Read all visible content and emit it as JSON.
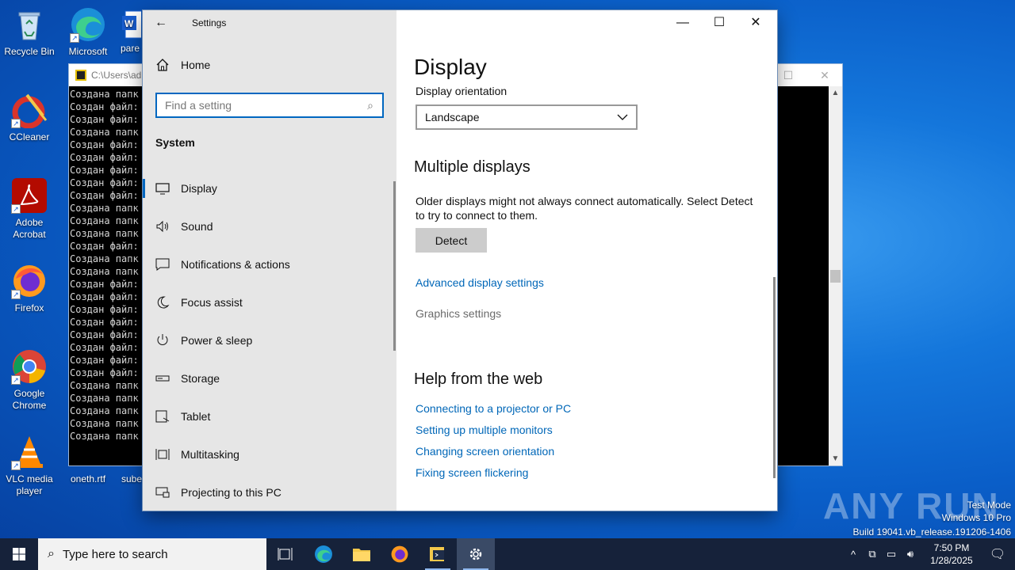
{
  "desktop": {
    "icons": [
      {
        "label": "Recycle Bin",
        "icon": "recycle-bin-icon"
      },
      {
        "label": "Microsoft Edge",
        "icon": "edge-icon"
      },
      {
        "label": "CCleaner",
        "icon": "ccleaner-icon"
      },
      {
        "label": "Adobe Acrobat",
        "icon": "acrobat-icon"
      },
      {
        "label": "Firefox",
        "icon": "firefox-icon"
      },
      {
        "label": "Google Chrome",
        "icon": "chrome-icon"
      },
      {
        "label": "VLC media player",
        "icon": "vlc-icon"
      }
    ],
    "partial_labels": [
      "pare",
      "oneth.rtf",
      "sube"
    ]
  },
  "console": {
    "title": "C:\\Users\\adı",
    "lines": [
      "Создана папк",
      "Создан файл:",
      "Создан файл:",
      "Создана папк",
      "Создан файл:",
      "Создан файл:",
      "Создан файл:",
      "Создан файл:",
      "Создан файл:",
      "Создана папк",
      "Создана папк",
      "Создана папк",
      "Создан файл:",
      "Создана папк",
      "Создана папк",
      "Создан файл:",
      "Создан файл:",
      "Создан файл:",
      "Создан файл:",
      "Создан файл:",
      "Создан файл:",
      "Создан файл:",
      "Создан файл:",
      "Создана папк",
      "Создана папк",
      "Создана папк",
      "Создана папк",
      "Создана папк"
    ]
  },
  "settings": {
    "app_title": "Settings",
    "home_label": "Home",
    "search_placeholder": "Find a setting",
    "section_title": "System",
    "nav_items": [
      {
        "label": "Display",
        "icon": "monitor-icon",
        "active": true
      },
      {
        "label": "Sound",
        "icon": "speaker-icon"
      },
      {
        "label": "Notifications & actions",
        "icon": "notification-icon"
      },
      {
        "label": "Focus assist",
        "icon": "moon-icon"
      },
      {
        "label": "Power & sleep",
        "icon": "power-icon"
      },
      {
        "label": "Storage",
        "icon": "storage-icon"
      },
      {
        "label": "Tablet",
        "icon": "tablet-icon"
      },
      {
        "label": "Multitasking",
        "icon": "multitasking-icon"
      },
      {
        "label": "Projecting to this PC",
        "icon": "projecting-icon"
      }
    ],
    "content": {
      "page_title": "Display",
      "orientation_label": "Display orientation",
      "orientation_value": "Landscape",
      "multiple_heading": "Multiple displays",
      "multiple_text": "Older displays might not always connect automatically. Select Detect to try to connect to them.",
      "detect_label": "Detect",
      "advanced_link": "Advanced display settings",
      "graphics_link": "Graphics settings",
      "help_heading": "Help from the web",
      "help_links": [
        "Connecting to a projector or PC",
        "Setting up multiple monitors",
        "Changing screen orientation",
        "Fixing screen flickering"
      ]
    }
  },
  "watermark": {
    "logo": "ANY RUN",
    "line1": "Test Mode",
    "line2": "Windows 10 Pro",
    "line3": "Build 19041.vb_release.191206-1406"
  },
  "taskbar": {
    "search_placeholder": "Type here to search",
    "time": "7:50 PM",
    "date": "1/28/2025",
    "apps": [
      "task-view-icon",
      "edge-icon",
      "file-explorer-icon",
      "firefox-icon",
      "script-app-icon",
      "settings-gear-icon"
    ]
  },
  "colors": {
    "accent": "#0067c0",
    "link": "#0067b8",
    "taskbar": "#16223a",
    "nav_bg": "#e6e6e6"
  }
}
